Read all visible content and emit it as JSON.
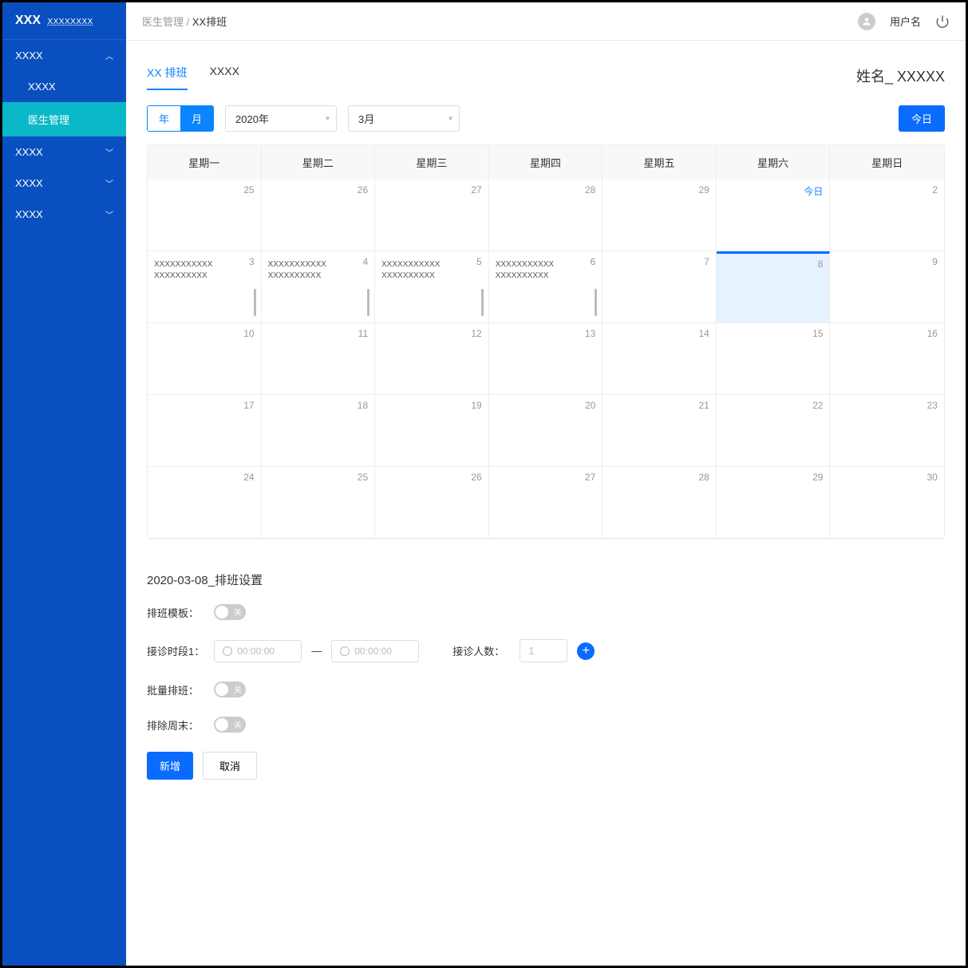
{
  "sidebar": {
    "logo_main": "XXX",
    "logo_sub": "XXXXXXXX",
    "groups": [
      {
        "label": "XXXX",
        "expanded": true,
        "children": [
          {
            "label": "XXXX"
          },
          {
            "label": "医生管理",
            "active": true
          }
        ]
      },
      {
        "label": "XXXX"
      },
      {
        "label": "XXXX"
      },
      {
        "label": "XXXX"
      }
    ]
  },
  "topbar": {
    "crumb_parent": "医生管理",
    "crumb_sep": " / ",
    "crumb_current": "XX排班",
    "username": "用户名"
  },
  "tabs": {
    "items": [
      {
        "label": "XX 排班",
        "active": true
      },
      {
        "label": "XXXX"
      }
    ],
    "name_label": "姓名_ XXXXX"
  },
  "controls": {
    "seg_year": "年",
    "seg_month": "月",
    "year_select": "2020年",
    "month_select": "3月",
    "today_btn": "今日"
  },
  "calendar": {
    "weekdays": [
      "星期一",
      "星期二",
      "星期三",
      "星期四",
      "星期五",
      "星期六",
      "星期日"
    ],
    "cells": [
      {
        "num": "25"
      },
      {
        "num": "26"
      },
      {
        "num": "27"
      },
      {
        "num": "28"
      },
      {
        "num": "29"
      },
      {
        "today": "今日"
      },
      {
        "num": "2"
      },
      {
        "num": "3",
        "ev": [
          "XXXXXXXXXXX",
          "XXXXXXXXXX"
        ],
        "bar": true
      },
      {
        "num": "4",
        "ev": [
          "XXXXXXXXXXX",
          "XXXXXXXXXX"
        ],
        "bar": true
      },
      {
        "num": "5",
        "ev": [
          "XXXXXXXXXXX",
          "XXXXXXXXXX"
        ],
        "bar": true
      },
      {
        "num": "6",
        "ev": [
          "XXXXXXXXXXX",
          "XXXXXXXXXX"
        ],
        "bar": true
      },
      {
        "num": "7"
      },
      {
        "num": "8",
        "selected": true
      },
      {
        "num": "9"
      },
      {
        "num": "10"
      },
      {
        "num": "11"
      },
      {
        "num": "12"
      },
      {
        "num": "13"
      },
      {
        "num": "14"
      },
      {
        "num": "15"
      },
      {
        "num": "16"
      },
      {
        "num": "17"
      },
      {
        "num": "18"
      },
      {
        "num": "19"
      },
      {
        "num": "20"
      },
      {
        "num": "21"
      },
      {
        "num": "22"
      },
      {
        "num": "23"
      },
      {
        "num": "24"
      },
      {
        "num": "25"
      },
      {
        "num": "26"
      },
      {
        "num": "27"
      },
      {
        "num": "28"
      },
      {
        "num": "29"
      },
      {
        "num": "30"
      }
    ]
  },
  "form": {
    "title": "2020-03-08_排班设置",
    "template_label": "排班模板：",
    "toggle_off_text": "关",
    "timeslot_label": "接诊时段1：",
    "time_placeholder": "00:00:00",
    "dash": "—",
    "count_label": "接诊人数：",
    "count_placeholder": "1",
    "batch_label": "批量排班：",
    "exclude_weekend_label": "排除周末：",
    "add_btn": "新增",
    "cancel_btn": "取消"
  }
}
